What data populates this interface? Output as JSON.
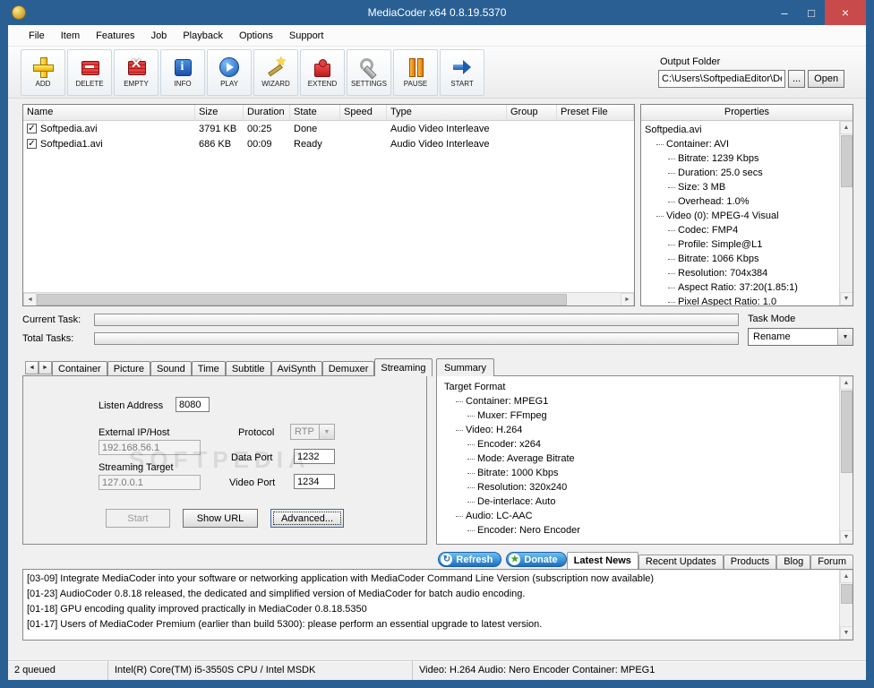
{
  "window": {
    "title": "MediaCoder x64 0.8.19.5370",
    "controls": {
      "minimize": "–",
      "maximize": "□",
      "close": "×"
    }
  },
  "menu": {
    "items": [
      "File",
      "Item",
      "Features",
      "Job",
      "Playback",
      "Options",
      "Support"
    ]
  },
  "toolbar": {
    "buttons": [
      {
        "label": "ADD",
        "icon": "add-icon"
      },
      {
        "label": "DELETE",
        "icon": "delete-icon"
      },
      {
        "label": "EMPTY",
        "icon": "empty-icon"
      },
      {
        "label": "INFO",
        "icon": "info-icon"
      },
      {
        "label": "PLAY",
        "icon": "play-icon"
      },
      {
        "label": "WIZARD",
        "icon": "wizard-icon"
      },
      {
        "label": "EXTEND",
        "icon": "extend-icon"
      },
      {
        "label": "SETTINGS",
        "icon": "settings-icon"
      },
      {
        "label": "PAUSE",
        "icon": "pause-icon"
      },
      {
        "label": "START",
        "icon": "start-icon"
      }
    ],
    "output_folder": {
      "label": "Output Folder",
      "path": "C:\\Users\\SoftpediaEditor\\Desktop",
      "browse": "...",
      "open": "Open"
    }
  },
  "file_list": {
    "columns": [
      "Name",
      "Size",
      "Duration",
      "State",
      "Speed",
      "Type",
      "Group",
      "Preset File"
    ],
    "rows": [
      {
        "checked": true,
        "name": "Softpedia.avi",
        "size": "3791 KB",
        "duration": "00:25",
        "state": "Done",
        "speed": "",
        "type": "Audio Video Interleave",
        "group": "",
        "preset_file": ""
      },
      {
        "checked": true,
        "name": "Softpedia1.avi",
        "size": "686 KB",
        "duration": "00:09",
        "state": "Ready",
        "speed": "",
        "type": "Audio Video Interleave",
        "group": "",
        "preset_file": ""
      }
    ]
  },
  "properties": {
    "title": "Properties",
    "tree": [
      {
        "level": 0,
        "text": "Softpedia.avi"
      },
      {
        "level": 1,
        "text": "Container: AVI"
      },
      {
        "level": 2,
        "text": "Bitrate: 1239 Kbps"
      },
      {
        "level": 2,
        "text": "Duration: 25.0 secs"
      },
      {
        "level": 2,
        "text": "Size: 3 MB"
      },
      {
        "level": 2,
        "text": "Overhead: 1.0%"
      },
      {
        "level": 1,
        "text": "Video (0): MPEG-4 Visual"
      },
      {
        "level": 2,
        "text": "Codec: FMP4"
      },
      {
        "level": 2,
        "text": "Profile: Simple@L1"
      },
      {
        "level": 2,
        "text": "Bitrate: 1066 Kbps"
      },
      {
        "level": 2,
        "text": "Resolution: 704x384"
      },
      {
        "level": 2,
        "text": "Aspect Ratio: 37:20(1.85:1)"
      },
      {
        "level": 2,
        "text": "Pixel Aspect Ratio: 1.0"
      }
    ]
  },
  "tasks": {
    "current_label": "Current Task:",
    "total_label": "Total Tasks:",
    "task_mode_label": "Task Mode",
    "task_mode_value": "Rename"
  },
  "tabs": {
    "items": [
      "Container",
      "Picture",
      "Sound",
      "Time",
      "Subtitle",
      "AviSynth",
      "Demuxer",
      "Streaming"
    ],
    "active": "Streaming",
    "summary_tab": "Summary",
    "scroll_left": "◄",
    "scroll_right": "►"
  },
  "streaming": {
    "listen_address_label": "Listen Address",
    "listen_address_value": "8080",
    "external_ip_label": "External IP/Host",
    "external_ip_value": "192.168.56.1",
    "streaming_target_label": "Streaming Target",
    "streaming_target_value": "127.0.0.1",
    "protocol_label": "Protocol",
    "protocol_value": "RTP",
    "data_port_label": "Data Port",
    "data_port_value": "1232",
    "video_port_label": "Video Port",
    "video_port_value": "1234",
    "start_button": "Start",
    "show_url_button": "Show URL",
    "advanced_button": "Advanced..."
  },
  "summary": {
    "tree": [
      {
        "level": 0,
        "text": "Target Format"
      },
      {
        "level": 1,
        "text": "Container: MPEG1"
      },
      {
        "level": 2,
        "text": "Muxer: FFmpeg"
      },
      {
        "level": 1,
        "text": "Video: H.264"
      },
      {
        "level": 2,
        "text": "Encoder: x264"
      },
      {
        "level": 2,
        "text": "Mode: Average Bitrate"
      },
      {
        "level": 2,
        "text": "Bitrate: 1000 Kbps"
      },
      {
        "level": 2,
        "text": "Resolution: 320x240"
      },
      {
        "level": 2,
        "text": "De-interlace: Auto"
      },
      {
        "level": 1,
        "text": "Audio: LC-AAC"
      },
      {
        "level": 2,
        "text": "Encoder: Nero Encoder"
      }
    ]
  },
  "news": {
    "tabs": [
      "Latest News",
      "Recent Updates",
      "Products",
      "Blog",
      "Forum"
    ],
    "active_tab": "Latest News",
    "refresh_button": "Refresh",
    "donate_button": "Donate",
    "items": [
      "[03-09] Integrate MediaCoder into your software or networking application with MediaCoder Command Line Version (subscription now available)",
      "[01-23] AudioCoder 0.8.18 released, the dedicated and simplified version of MediaCoder for batch audio encoding.",
      "[01-18] GPU encoding quality improved practically in MediaCoder 0.8.18.5350",
      "[01-17] Users of MediaCoder Premium (earlier than build 5300): please perform an essential upgrade to latest version."
    ]
  },
  "statusbar": {
    "queued": "2 queued",
    "cpu": "Intel(R) Core(TM) i5-3550S CPU / Intel MSDK",
    "format": "Video: H.264  Audio: Nero Encoder  Container: MPEG1"
  },
  "watermark": "SOFTPEDIA",
  "colors": {
    "titlebar": "#2a5f93",
    "close_button": "#c94a4a",
    "accent_blue": "#1d6fc0"
  }
}
